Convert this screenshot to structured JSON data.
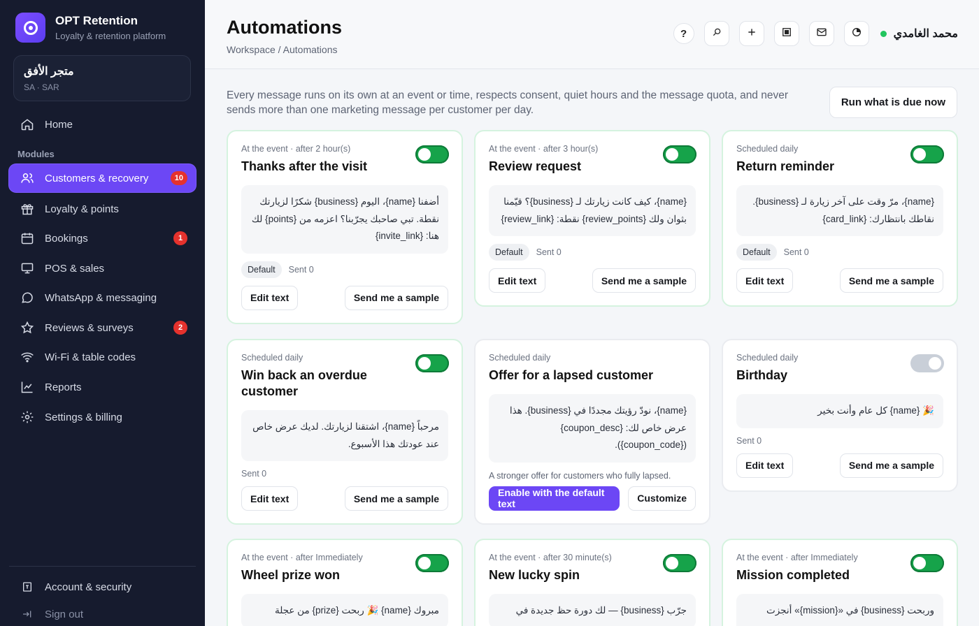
{
  "brand": {
    "title": "OPT Retention",
    "subtitle": "Loyalty & retention platform"
  },
  "store": {
    "name": "متجر الأفق",
    "region": "SA · SAR"
  },
  "sidebar": {
    "home": "Home",
    "modules_label": "Modules",
    "items": [
      {
        "label": "Customers & recovery",
        "badge": "10",
        "icon": "users-icon"
      },
      {
        "label": "Loyalty & points",
        "icon": "gift-icon"
      },
      {
        "label": "Bookings",
        "badge": "1",
        "icon": "calendar-icon"
      },
      {
        "label": "POS & sales",
        "icon": "monitor-icon"
      },
      {
        "label": "WhatsApp & messaging",
        "icon": "chat-icon"
      },
      {
        "label": "Reviews & surveys",
        "badge": "2",
        "icon": "star-icon"
      },
      {
        "label": "Wi-Fi & table codes",
        "icon": "wifi-icon"
      },
      {
        "label": "Reports",
        "icon": "chart-icon"
      },
      {
        "label": "Settings & billing",
        "icon": "gear-icon"
      }
    ],
    "account": "Account & security",
    "signout": "Sign out"
  },
  "header": {
    "title": "Automations",
    "breadcrumb": "Workspace / Automations",
    "user": "محمد الغامدي",
    "help": "?"
  },
  "intro": "Every message runs on its own at an event or time, respects consent, quiet hours and the message quota, and never sends more than one marketing message per customer per day.",
  "run_button": "Run what is due now",
  "labels": {
    "edit": "Edit text",
    "sample": "Send me a sample",
    "default": "Default",
    "enable_default": "Enable with the default text",
    "customize": "Customize"
  },
  "cards": [
    {
      "trigger": "At the event · after 2 hour(s)",
      "title": "Thanks after the visit",
      "message": "أضفنا {name}، اليوم {business} شكرًا لزيارتك نقطة. تبي صاحبك يجرّبنا؟ اعزمه من {points} لك هنا: {invite_link}",
      "sent": "Sent 0"
    },
    {
      "trigger": "At the event · after 3 hour(s)",
      "title": "Review request",
      "message": "{name}، كيف كانت زيارتك لـ {business}؟ قيّمنا بثوان ولك {review_points} نقطة: {review_link}",
      "sent": "Sent 0"
    },
    {
      "trigger": "Scheduled daily",
      "title": "Return reminder",
      "message": "{name}، مرّ وقت على آخر زيارة لـ {business}. نقاطك بانتظارك: {card_link}",
      "sent": "Sent 0"
    },
    {
      "trigger": "Scheduled daily",
      "title": "Win back an overdue customer",
      "message": "مرحباً {name}، اشتقنا لزيارتك. لديك عرض خاص عند عودتك هذا الأسبوع.",
      "sent": "Sent 0"
    },
    {
      "trigger": "Scheduled daily",
      "title": "Offer for a lapsed customer",
      "message": "{name}، نودّ رؤيتك مجددًا في {business}. هذا عرض خاص لك: {coupon_desc} ({coupon_code}).",
      "note": "A stronger offer for customers who fully lapsed."
    },
    {
      "trigger": "Scheduled daily",
      "title": "Birthday",
      "message": "🎉 {name} كل عام وأنت بخير",
      "sent": "Sent 0"
    },
    {
      "trigger": "At the event · after Immediately",
      "title": "Wheel prize won",
      "message": "مبروك {name} 🎉 ربحت {prize} من عجلة"
    },
    {
      "trigger": "At the event · after 30 minute(s)",
      "title": "New lucky spin",
      "message": "جرّب {business} — لك دورة حظ جديدة في"
    },
    {
      "trigger": "At the event · after Immediately",
      "title": "Mission completed",
      "message": "وربحت {business} في «{mission}» أنجزت مهمة"
    }
  ],
  "colors": {
    "accent": "#6c47f5",
    "toggle_on": "#16a34a",
    "badge": "#e5322d",
    "sidebar": "#161b2e"
  }
}
